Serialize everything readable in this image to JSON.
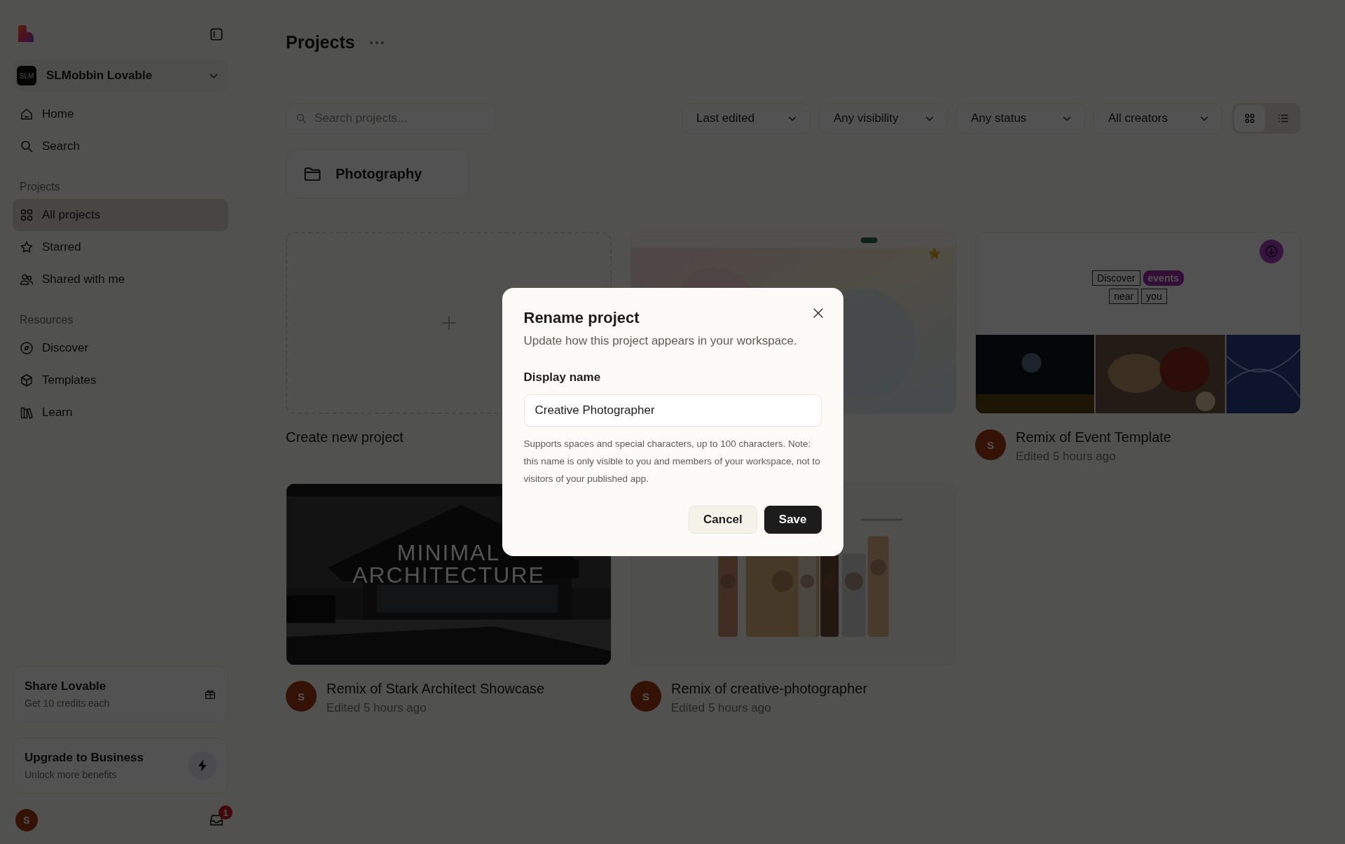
{
  "sidebar": {
    "workspace": {
      "initials": "SLM",
      "name": "SLMobbin Lovable"
    },
    "nav": [
      {
        "label": "Home",
        "selected": false
      },
      {
        "label": "Search",
        "selected": false
      }
    ],
    "sections": [
      {
        "heading": "Projects",
        "items": [
          {
            "label": "All projects",
            "selected": true
          },
          {
            "label": "Starred",
            "selected": false
          },
          {
            "label": "Shared with me",
            "selected": false
          }
        ]
      },
      {
        "heading": "Resources",
        "items": [
          {
            "label": "Discover",
            "selected": false
          },
          {
            "label": "Templates",
            "selected": false
          },
          {
            "label": "Learn",
            "selected": false
          }
        ]
      }
    ],
    "promos": [
      {
        "title": "Share Lovable",
        "subtitle": "Get 10 credits each"
      },
      {
        "title": "Upgrade to Business",
        "subtitle": "Unlock more benefits"
      }
    ],
    "user": {
      "initial": "S"
    },
    "inbox": {
      "badge": "1"
    }
  },
  "header": {
    "title": "Projects"
  },
  "toolbar": {
    "search": {
      "placeholder": "Search projects..."
    },
    "filters": [
      "Last edited",
      "Any visibility",
      "Any status",
      "All creators"
    ],
    "views": [
      {
        "selected": true
      },
      {
        "selected": false
      }
    ]
  },
  "folders": [
    {
      "name": "Photography"
    }
  ],
  "projects": [
    {
      "kind": "create",
      "title": "Create new project"
    },
    {
      "kind": "pastel",
      "starred": true
    },
    {
      "kind": "events",
      "title": "Remix of Event Template",
      "subtitle": "Edited 5 hours ago",
      "avatar": "S",
      "words": [
        {
          "text": "Discover",
          "highlighted": false
        },
        {
          "text": "events",
          "highlighted": true
        },
        {
          "text": "near",
          "highlighted": false
        },
        {
          "text": "you",
          "highlighted": false
        }
      ]
    },
    {
      "kind": "architecture",
      "title": "Remix of Stark Architect Showcase",
      "subtitle": "Edited 5 hours ago",
      "avatar": "S",
      "headline": [
        "MINIMAL",
        "ARCHITECTURE"
      ]
    },
    {
      "kind": "portraits",
      "title": "Remix of creative-photographer",
      "subtitle": "Edited 5 hours ago",
      "avatar": "S"
    }
  ],
  "dialog": {
    "title": "Rename project",
    "description": "Update how this project appears in your workspace.",
    "field_label": "Display name",
    "value": "Creative Photographer",
    "help": "Supports spaces and special characters, up to 100 characters. Note: this name is only visible to you and members of your workspace, not to visitors of your published app.",
    "buttons": [
      {
        "label": "Cancel",
        "kind": "secondary"
      },
      {
        "label": "Save",
        "kind": "primary"
      }
    ]
  }
}
